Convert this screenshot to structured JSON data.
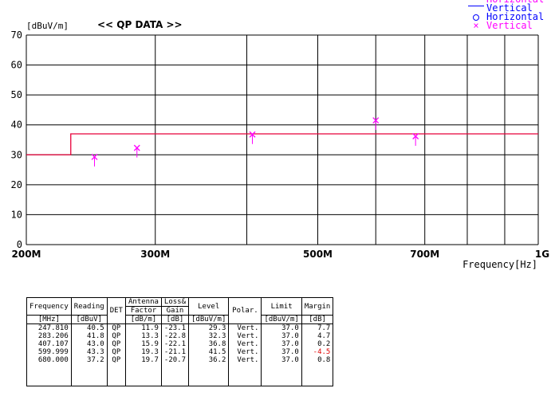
{
  "legend": [
    {
      "symbol": "line",
      "label": "Horizontal",
      "color": "#ff00ff"
    },
    {
      "symbol": "line",
      "label": "Vertical",
      "color": "#0000ff"
    },
    {
      "symbol": "o",
      "label": "Horizontal",
      "color": "#0000ff"
    },
    {
      "symbol": "x",
      "label": "Vertical",
      "color": "#ff00ff"
    }
  ],
  "chart_data": {
    "type": "scatter",
    "title": "<< QP DATA >>",
    "ylabel": "[dBuV/m]",
    "xlabel": "Frequency[Hz]",
    "ylim": [
      0,
      70
    ],
    "yticks": [
      "0",
      "10",
      "20",
      "30",
      "40",
      "50",
      "60",
      "70"
    ],
    "xticks": [
      "200M",
      "300M",
      "500M",
      "700M",
      "1G"
    ],
    "grid": true,
    "limit_line": {
      "color": "#e8003a",
      "segments": [
        {
          "x_start": 200,
          "x_end": 230,
          "value": 30.0
        },
        {
          "x_start": 230,
          "x_end": 1000,
          "value": 37.0
        }
      ]
    },
    "series": [
      {
        "name": "Vertical",
        "marker": "x",
        "color": "#ff00ff",
        "points": [
          {
            "x": 247.81,
            "y": 29.3,
            "reading": 40.5
          },
          {
            "x": 283.206,
            "y": 32.3,
            "reading": 41.8
          },
          {
            "x": 407.107,
            "y": 36.8,
            "reading": 43.0
          },
          {
            "x": 599.999,
            "y": 41.5,
            "reading": 43.3
          },
          {
            "x": 680.0,
            "y": 36.2,
            "reading": 37.2
          }
        ]
      }
    ]
  },
  "table": {
    "headers": {
      "frequency": "Frequency",
      "reading": "Reading",
      "det": "DET",
      "antenna": "Antenna",
      "factor": "Factor",
      "loss": "Loss&",
      "gain": "Gain",
      "level": "Level",
      "polar": "Polar.",
      "limit": "Limit",
      "margin": "Margin"
    },
    "units": {
      "frequency": "[MHz]",
      "reading": "[dBuV]",
      "factor": "[dB/m]",
      "gain": "[dB]",
      "level": "[dBuV/m]",
      "limit": "[dBuV/m]",
      "margin": "[dB]"
    },
    "rows": [
      {
        "frequency": "247.810",
        "reading": "40.5",
        "det": "QP",
        "factor": "11.9",
        "gain": "-23.1",
        "level": "29.3",
        "polar": "Vert.",
        "limit": "37.0",
        "margin": "7.7",
        "negative": false
      },
      {
        "frequency": "283.206",
        "reading": "41.8",
        "det": "QP",
        "factor": "13.3",
        "gain": "-22.8",
        "level": "32.3",
        "polar": "Vert.",
        "limit": "37.0",
        "margin": "4.7",
        "negative": false
      },
      {
        "frequency": "407.107",
        "reading": "43.0",
        "det": "QP",
        "factor": "15.9",
        "gain": "-22.1",
        "level": "36.8",
        "polar": "Vert.",
        "limit": "37.0",
        "margin": "0.2",
        "negative": false
      },
      {
        "frequency": "599.999",
        "reading": "43.3",
        "det": "QP",
        "factor": "19.3",
        "gain": "-21.1",
        "level": "41.5",
        "polar": "Vert.",
        "limit": "37.0",
        "margin": "-4.5",
        "negative": true
      },
      {
        "frequency": "680.000",
        "reading": "37.2",
        "det": "QP",
        "factor": "19.7",
        "gain": "-20.7",
        "level": "36.2",
        "polar": "Vert.",
        "limit": "37.0",
        "margin": "0.8",
        "negative": false
      }
    ]
  }
}
